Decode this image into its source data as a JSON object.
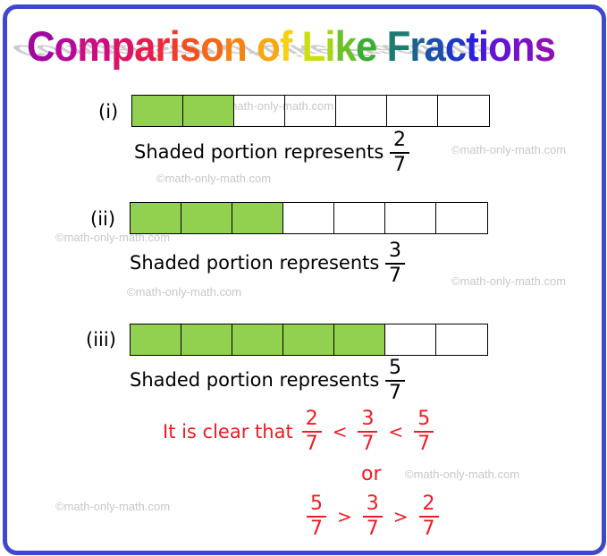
{
  "title": {
    "text": "Comparison of Like Fractions",
    "letters": [
      {
        "ch": "C",
        "color": "#a0089e"
      },
      {
        "ch": "o",
        "color": "#b8099a"
      },
      {
        "ch": "m",
        "color": "#cc0d84"
      },
      {
        "ch": "p",
        "color": "#dc1468"
      },
      {
        "ch": "a",
        "color": "#e61c50"
      },
      {
        "ch": "r",
        "color": "#ec2a3c"
      },
      {
        "ch": "i",
        "color": "#f03c2c"
      },
      {
        "ch": "s",
        "color": "#f25020"
      },
      {
        "ch": "o",
        "color": "#f46818"
      },
      {
        "ch": "n",
        "color": "#f68414"
      },
      {
        "ch": " ",
        "color": "#000000"
      },
      {
        "ch": "o",
        "color": "#f8a810"
      },
      {
        "ch": "f",
        "color": "#f8d010"
      },
      {
        "ch": " ",
        "color": "#000000"
      },
      {
        "ch": "L",
        "color": "#c8e010"
      },
      {
        "ch": "i",
        "color": "#a8d41c"
      },
      {
        "ch": "k",
        "color": "#6cc028"
      },
      {
        "ch": "e",
        "color": "#3cac34"
      },
      {
        "ch": " ",
        "color": "#000000"
      },
      {
        "ch": "F",
        "color": "#1c7c70"
      },
      {
        "ch": "r",
        "color": "#1c6490"
      },
      {
        "ch": "a",
        "color": "#1c50ac"
      },
      {
        "ch": "c",
        "color": "#2038c8"
      },
      {
        "ch": "t",
        "color": "#2c20e0"
      },
      {
        "ch": "i",
        "color": "#4818e0"
      },
      {
        "ch": "o",
        "color": "#6414d4"
      },
      {
        "ch": "n",
        "color": "#7c10c4"
      },
      {
        "ch": "s",
        "color": "#9010b4"
      }
    ]
  },
  "colors": {
    "frame": "#3f48cc",
    "shaded": "#92d050",
    "conclusion": "#ee1c24"
  },
  "examples": [
    {
      "label": "(i)",
      "total_parts": 7,
      "shaded_parts": 2,
      "caption": "Shaded portion represents",
      "numerator": "2",
      "denominator": "7"
    },
    {
      "label": "(ii)",
      "total_parts": 7,
      "shaded_parts": 3,
      "caption": "Shaded portion represents",
      "numerator": "3",
      "denominator": "7"
    },
    {
      "label": "(iii)",
      "total_parts": 7,
      "shaded_parts": 5,
      "caption": "Shaded portion represents",
      "numerator": "5",
      "denominator": "7"
    }
  ],
  "conclusion": {
    "intro": "It is clear that",
    "ascending": {
      "fractions": [
        {
          "n": "2",
          "d": "7"
        },
        {
          "n": "3",
          "d": "7"
        },
        {
          "n": "5",
          "d": "7"
        }
      ],
      "operators": [
        "<",
        "<"
      ]
    },
    "connector": "or",
    "descending": {
      "fractions": [
        {
          "n": "5",
          "d": "7"
        },
        {
          "n": "3",
          "d": "7"
        },
        {
          "n": "2",
          "d": "7"
        }
      ],
      "operators": [
        ">",
        ">"
      ]
    }
  },
  "watermark": "©math-only-math.com"
}
